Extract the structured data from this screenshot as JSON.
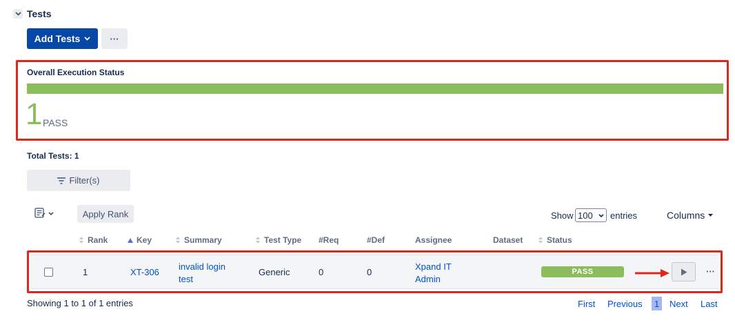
{
  "section": {
    "title": "Tests",
    "toggle_icon": "chevron-down-icon"
  },
  "toolbar": {
    "add_tests_label": "Add Tests",
    "more_label": "···"
  },
  "execution_status": {
    "title": "Overall Execution Status",
    "count": "1",
    "status_label": "PASS",
    "pass_fraction": 1.0,
    "pass_color": "#8cbd5d"
  },
  "summary": {
    "total_tests": "Total Tests: 1"
  },
  "filter": {
    "label": "Filter(s)"
  },
  "rank": {
    "apply_label": "Apply Rank",
    "icon": "rank-list-icon"
  },
  "table_controls": {
    "show_label": "Show",
    "page_size": "100",
    "entries_label": "entries",
    "columns_label": "Columns"
  },
  "table": {
    "headers": [
      "Rank",
      "Key",
      "Summary",
      "Test Type",
      "#Req",
      "#Def",
      "Assignee",
      "Dataset",
      "Status"
    ],
    "rows": [
      {
        "rank": "1",
        "key": "XT-306",
        "summary_line1": "invalid login",
        "summary_line2": "test",
        "test_type": "Generic",
        "req": "0",
        "def": "0",
        "assignee_line1": "Xpand IT",
        "assignee_line2": "Admin",
        "dataset": "",
        "status": "PASS"
      }
    ]
  },
  "footer": {
    "showing": "Showing 1 to 1 of 1 entries",
    "first": "First",
    "previous": "Previous",
    "current_page": "1",
    "next": "Next",
    "last": "Last"
  },
  "colors": {
    "primary": "#0747a6",
    "pass": "#8cbd5d",
    "highlight": "#e0261b",
    "link": "#0052cc"
  }
}
